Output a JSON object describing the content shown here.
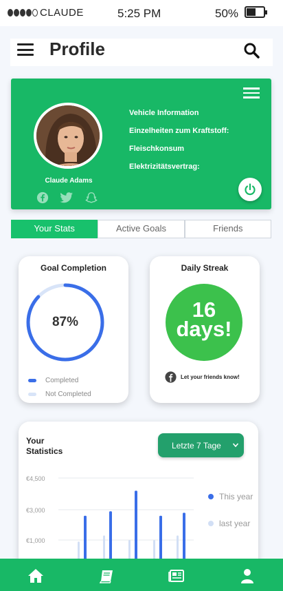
{
  "status_bar": {
    "carrier": "CLAUDE",
    "time": "5:25 PM",
    "battery": "50%",
    "battery_level": 0.5
  },
  "header": {
    "title": "Profile",
    "menu_icon": "hamburger-icon",
    "search_icon": "search-icon"
  },
  "profile": {
    "name": "Claude Adams",
    "info": [
      "Vehicle Information",
      "Einzelheiten zum Kraftstoff:",
      "Fleischkonsum",
      "Elektrizitätsvertrag:"
    ],
    "social_icons": [
      "facebook-icon",
      "twitter-icon",
      "snapchat-icon"
    ],
    "colors": {
      "card": "#18b866",
      "accent": "#18c16c"
    }
  },
  "tabs": [
    {
      "label": "Your Stats",
      "active": true
    },
    {
      "label": "Active Goals",
      "active": false
    },
    {
      "label": "Friends",
      "active": false
    }
  ],
  "goal_card": {
    "title": "Goal Completion",
    "value": "87%",
    "fraction": 0.87,
    "legend": [
      {
        "label": "Completed",
        "color": "#3a6ee8"
      },
      {
        "label": "Not Completed",
        "color": "#d8e4f8"
      }
    ]
  },
  "streak_card": {
    "title": "Daily Streak",
    "number": "16",
    "unit": "days!",
    "share_text": "Let your friends know!"
  },
  "statistics": {
    "title": "Your Statistics",
    "range": "Letzte 7 Tage",
    "legend": [
      {
        "label": "This year",
        "color": "#3a6ee8"
      },
      {
        "label": "last year",
        "color": "#d2dff5"
      }
    ]
  },
  "chart_data": {
    "type": "bar",
    "y_ticks": [
      "€4,500",
      "€3,000",
      "€1,000"
    ],
    "series": [
      {
        "name": "This year",
        "values": [
          2600,
          2900,
          3900,
          2600,
          2800
        ]
      },
      {
        "name": "last year",
        "values": [
          900,
          1300,
          1000,
          1000,
          1300
        ]
      }
    ],
    "grid": true
  },
  "bottom_nav": [
    {
      "icon": "home-icon"
    },
    {
      "icon": "book-icon"
    },
    {
      "icon": "news-icon"
    },
    {
      "icon": "user-icon"
    }
  ]
}
